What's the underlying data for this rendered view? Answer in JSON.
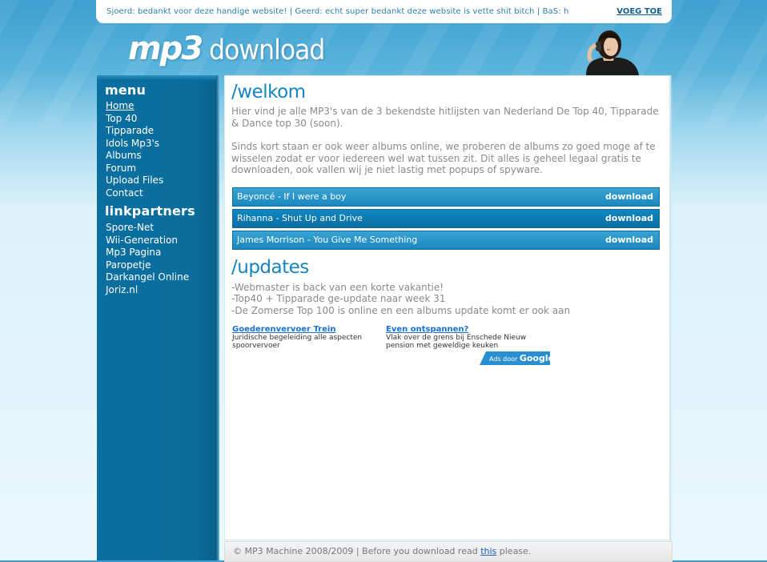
{
  "shoutbox": {
    "text": "Sjoerd: bedankt voor deze handige website! | Geerd: echt super bedankt deze website is vette shit bitch | BaS: h",
    "add_label": "VOEG TOE"
  },
  "logo": {
    "part1": "mp3",
    "part2": " download"
  },
  "sidebar": {
    "menu_heading": "menu",
    "menu_items": [
      "Home",
      "Top 40",
      "Tipparade",
      "Idols Mp3's",
      "Albums",
      "Forum",
      "Upload Files",
      "Contact"
    ],
    "partners_heading": "linkpartners",
    "partner_items": [
      "Spore-Net",
      "Wii-Generation",
      "Mp3 Pagina",
      "Paropetje",
      "Darkangel Online",
      "Joriz.nl"
    ]
  },
  "welcome": {
    "heading": "/welkom",
    "intro": "Hier vind je alle MP3's van de 3 bekendste hitlijsten van Nederland De Top 40, Tipparade & Dance top 30 (soon).",
    "body": "Sinds kort staan er ook weer albums online, we proberen de albums zo  goed moge af te wisselen zodat er voor iedereen wel wat tussen zit. Dit alles is geheel legaal gratis te downloaden, ook vallen wij je niet  lastig met popups of spyware."
  },
  "downloads": [
    {
      "title": "Beyoncé - If I were a boy",
      "action": "download"
    },
    {
      "title": "Rihanna - Shut Up and Drive",
      "action": "download"
    },
    {
      "title": "James Morrison - You Give Me Something",
      "action": "download"
    }
  ],
  "updates": {
    "heading": "/updates",
    "items": [
      "-Webmaster is back van een korte vakantie!",
      "-Top40 + Tipparade ge-update naar week 31",
      "-De Zomerse Top 100 is online en een albums update komt er ook aan"
    ]
  },
  "ads": [
    {
      "title": "Goederenvervoer Trein",
      "desc": "Juridische begeleiding alle aspecten spoorvervoer"
    },
    {
      "title": "Even ontspannen?",
      "desc": "Vlak over de grens bij Enschede Nieuw pension met geweldige keuken"
    }
  ],
  "ads_by": {
    "prefix": "Ads door ",
    "brand": "Google"
  },
  "footer": {
    "prefix": "© MP3 Machine 2008/2009 | Before you download read ",
    "link": "this",
    "suffix": " please."
  }
}
